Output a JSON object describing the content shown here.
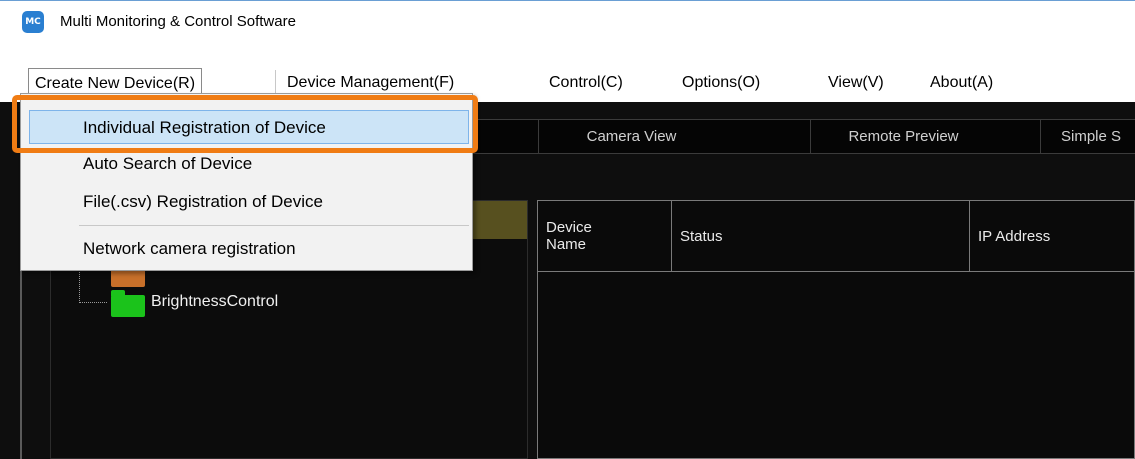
{
  "window": {
    "title": "Multi Monitoring & Control Software",
    "icon": "app-logo-icon",
    "icon_text": "MC"
  },
  "menubar": {
    "items": [
      {
        "label": "Create New Device(R)"
      },
      {
        "label": "Device Management(F)"
      },
      {
        "label": "Control(C)"
      },
      {
        "label": "Options(O)"
      },
      {
        "label": "View(V)"
      },
      {
        "label": "About(A)"
      }
    ]
  },
  "dropdown": {
    "items": [
      {
        "label": "Individual Registration of Device",
        "highlighted": true
      },
      {
        "label": "Auto Search of Device"
      },
      {
        "label": "File(.csv) Registration of Device"
      },
      {
        "label": "Network camera registration"
      }
    ]
  },
  "view_tabs": [
    {
      "label": "Camera View"
    },
    {
      "label": "Remote Preview"
    },
    {
      "label": "Simple S"
    }
  ],
  "tree": {
    "items": [
      {
        "label": "BrightnessControl",
        "icon": "folder-icon"
      }
    ]
  },
  "grid": {
    "columns": [
      {
        "label": "Device\nName"
      },
      {
        "label": "Status"
      },
      {
        "label": "IP Address"
      }
    ]
  },
  "colors": {
    "highlight_outline": "#f07c14",
    "menu_highlight": "#cce4f7",
    "tree_selection": "#57501f",
    "folder_green": "#1bc31b",
    "folder_orange": "#c8702a"
  }
}
